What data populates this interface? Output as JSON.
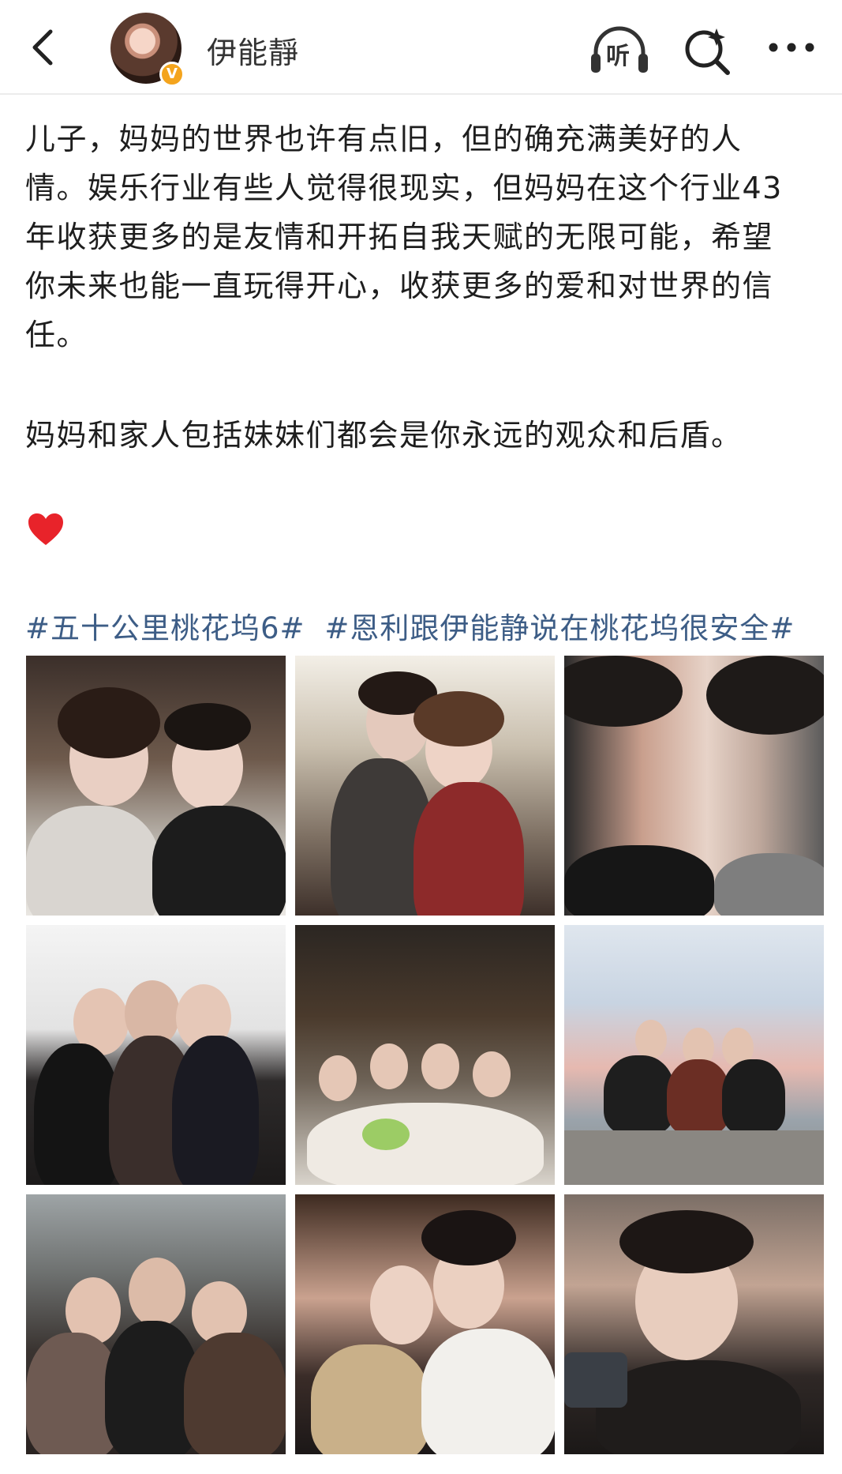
{
  "header": {
    "back_icon": "chevron-left-icon",
    "username": "伊能靜",
    "verify_badge": "V",
    "listen_label": "听",
    "search_icon": "search-sparkle-icon",
    "more_icon": "more-dots-icon"
  },
  "post": {
    "lines": [
      "儿子，妈妈的世界也许有点旧，但的确充满美好的人",
      "情。娱乐行业有些人觉得很现实，但妈妈在这个行业43",
      "年收获更多的是友情和开拓自我天赋的无限可能，希望",
      "你未来也能一直玩得开心，收获更多的爱和对世界的信",
      "任。"
    ],
    "paragraph2": "妈妈和家人包括妹妹们都会是你永远的观众和后盾。",
    "emoji": "heart-icon",
    "hashtags": [
      "#五十公里桃花坞6#",
      "#恩利跟伊能静说在桃花坞很安全#"
    ]
  },
  "colors": {
    "hashtag": "#3d5d86",
    "heart": "#e8232a",
    "badge": "#f4a41d"
  }
}
